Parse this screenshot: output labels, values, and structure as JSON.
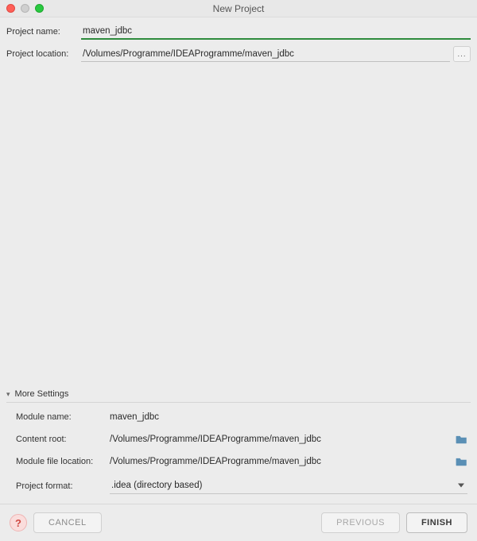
{
  "window": {
    "title": "New Project"
  },
  "fields": {
    "project_name": {
      "label": "Project name:",
      "value": "maven_jdbc"
    },
    "project_location": {
      "label": "Project location:",
      "value": "/Volumes/Programme/IDEAProgramme/maven_jdbc",
      "browse_label": "..."
    }
  },
  "more_settings": {
    "header": "More Settings",
    "module_name": {
      "label": "Module name:",
      "value": "maven_jdbc"
    },
    "content_root": {
      "label": "Content root:",
      "value": "/Volumes/Programme/IDEAProgramme/maven_jdbc"
    },
    "module_file_location": {
      "label": "Module file location:",
      "value": "/Volumes/Programme/IDEAProgramme/maven_jdbc"
    },
    "project_format": {
      "label": "Project format:",
      "value": ".idea (directory based)"
    }
  },
  "buttons": {
    "help": "?",
    "cancel": "CANCEL",
    "previous": "PREVIOUS",
    "finish": "FINISH"
  },
  "icons": {
    "folder_color": "#5a8fb5"
  }
}
